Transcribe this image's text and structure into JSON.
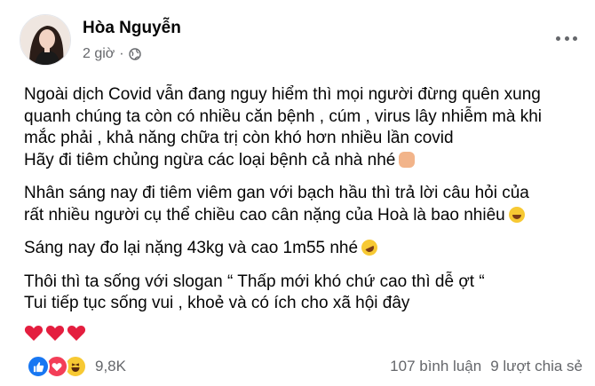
{
  "post": {
    "author": "Hòa Nguyễn",
    "time": "2 giờ",
    "separator": "·",
    "privacy_icon": "globe-icon",
    "paragraphs": [
      {
        "lines": [
          "Ngoài dịch Covid vẫn đang nguy hiểm thì mọi người đừng quên xung",
          "quanh chúng ta còn có nhiều căn bệnh , cúm , virus lây nhiễm mà khi",
          "mắc phải , khả năng chữa trị còn khó hơn nhiều lần covid",
          "Hãy đi tiêm chủng ngừa các loại bệnh cả nhà nhé"
        ],
        "emoji": "fist-emoji"
      },
      {
        "lines": [
          "Nhân sáng nay đi tiêm viêm gan với bạch hầu thì trả lời câu hỏi của",
          "rất nhiều người cụ thể chiều cao cân nặng của Hoà là bao nhiêu"
        ],
        "emoji": "laughing-emoji"
      },
      {
        "lines": [
          "Sáng nay đo lại nặng 43kg và cao 1m55 nhé"
        ],
        "emoji": "rofl-emoji"
      },
      {
        "lines": [
          "Thôi thì ta sống với slogan “ Thấp mới khó chứ cao thì dễ ợt “",
          "Tui tiếp tục sống vui , khoẻ và có ích cho xã hội đây"
        ]
      }
    ],
    "hearts_count": 3,
    "reactions": [
      "like-icon",
      "love-icon",
      "haha-icon"
    ],
    "reaction_count": "9,8K",
    "comments": "107 bình luận",
    "shares": "9 lượt chia sẻ"
  },
  "colors": {
    "text": "#050505",
    "secondary": "#65676b",
    "like": "#1877f2",
    "love": "#f33e58",
    "heart": "#e41e3f"
  }
}
